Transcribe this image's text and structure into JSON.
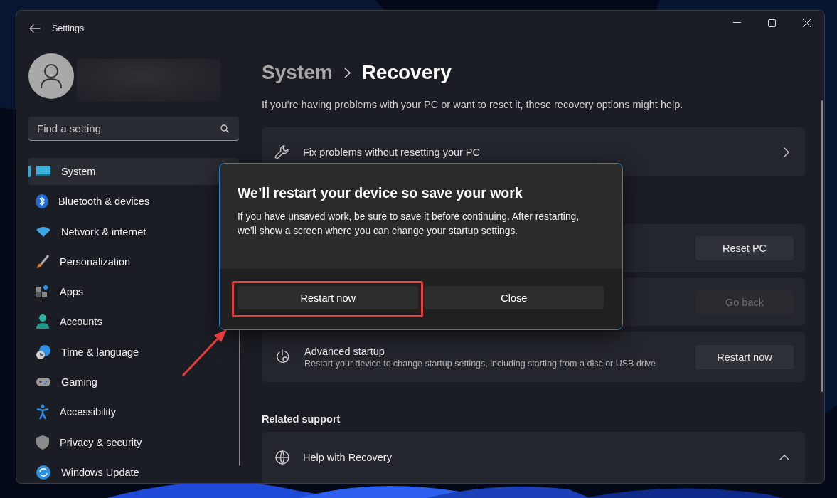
{
  "window": {
    "title": "Settings"
  },
  "search": {
    "placeholder": "Find a setting"
  },
  "sidebar": {
    "items": [
      {
        "label": "System",
        "selected": true
      },
      {
        "label": "Bluetooth & devices",
        "selected": false
      },
      {
        "label": "Network & internet",
        "selected": false
      },
      {
        "label": "Personalization",
        "selected": false
      },
      {
        "label": "Apps",
        "selected": false
      },
      {
        "label": "Accounts",
        "selected": false
      },
      {
        "label": "Time & language",
        "selected": false
      },
      {
        "label": "Gaming",
        "selected": false
      },
      {
        "label": "Accessibility",
        "selected": false
      },
      {
        "label": "Privacy & security",
        "selected": false
      },
      {
        "label": "Windows Update",
        "selected": false
      }
    ]
  },
  "breadcrumb": [
    {
      "label": "System"
    },
    {
      "label": "Recovery"
    }
  ],
  "description": "If you’re having problems with your PC or want to reset it, these recovery options might help.",
  "cards": [
    {
      "kind": "link",
      "title": "Fix problems without resetting your PC"
    },
    {
      "kind": "button",
      "button": "Reset PC",
      "disabled": false
    },
    {
      "kind": "button",
      "button": "Go back",
      "disabled": true
    },
    {
      "kind": "button",
      "title": "Advanced startup",
      "subtitle": "Restart your device to change startup settings, including starting from a disc or USB drive",
      "button": "Restart now",
      "disabled": false
    }
  ],
  "related_support": {
    "heading": "Related support",
    "items": [
      {
        "title": "Help with Recovery",
        "expanded": true
      }
    ]
  },
  "dialog": {
    "title": "We’ll restart your device so save your work",
    "body": "If you have unsaved work, be sure to save it before continuing. After restarting, we’ll show a screen where you can change your startup settings.",
    "buttons": [
      {
        "label": "Restart now",
        "highlighted": true
      },
      {
        "label": "Close",
        "highlighted": false
      }
    ]
  }
}
